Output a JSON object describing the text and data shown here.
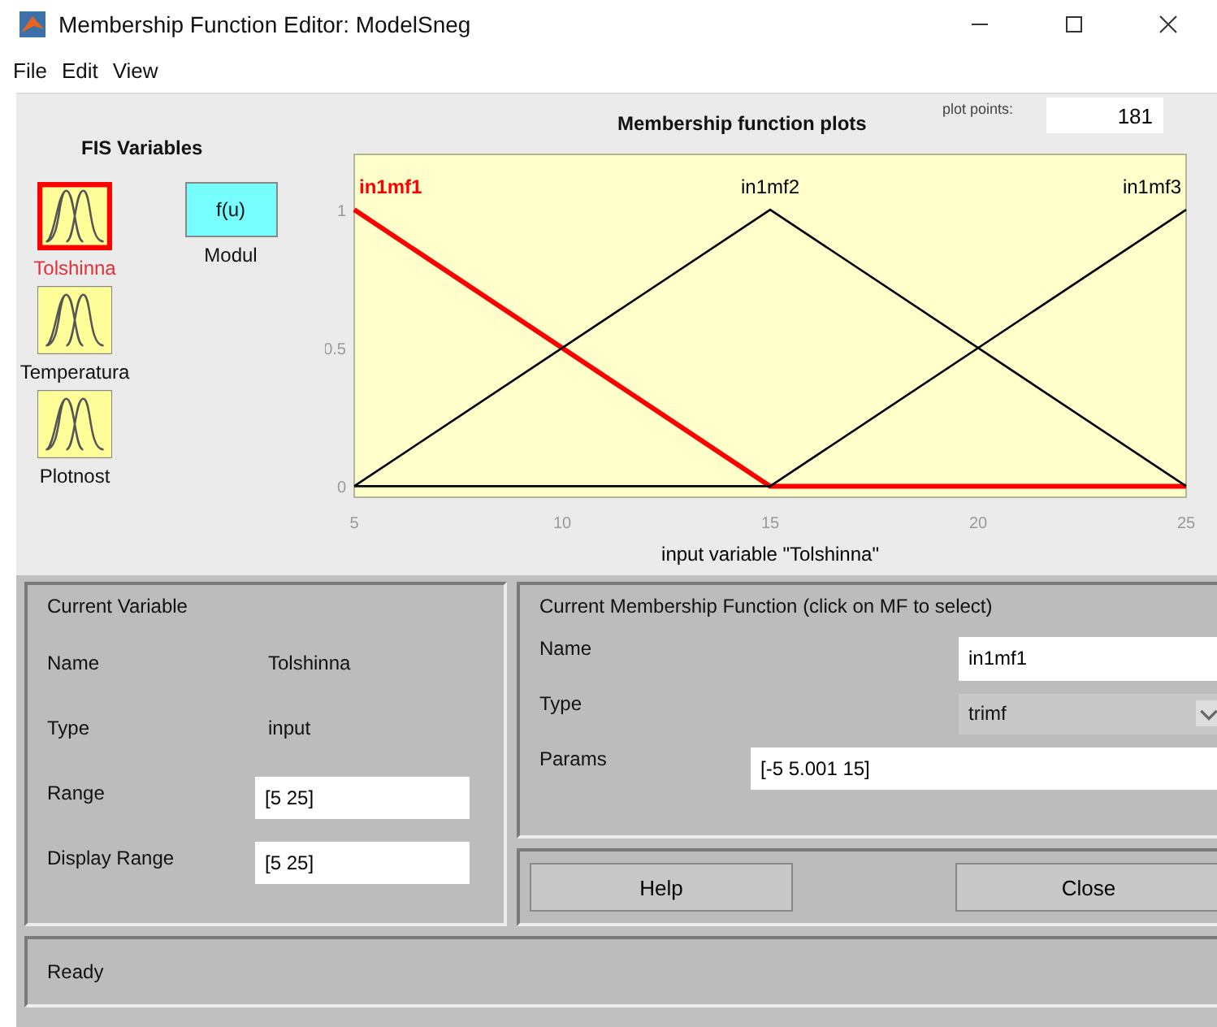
{
  "window": {
    "title": "Membership Function Editor: ModelSneg"
  },
  "menu": [
    "File",
    "Edit",
    "View"
  ],
  "fis_variables": {
    "title": "FIS Variables",
    "items": [
      {
        "label": "Tolshinna",
        "kind": "input",
        "selected": true
      },
      {
        "label": "Modul",
        "kind": "output",
        "icon_text": "f(u)",
        "selected": false
      },
      {
        "label": "Temperatura",
        "kind": "input",
        "selected": false
      },
      {
        "label": "Plotnost",
        "kind": "input",
        "selected": false
      }
    ]
  },
  "plot_points": {
    "label": "plot points:",
    "value": "181"
  },
  "plot": {
    "chart_data": {
      "type": "line",
      "title": "Membership function plots",
      "xlabel": "input variable \"Tolshinna\"",
      "x": [
        5,
        15,
        25
      ],
      "series": [
        {
          "name": "in1mf1",
          "color": "#ff0000",
          "values": [
            1,
            0,
            0
          ]
        },
        {
          "name": "in1mf2",
          "color": "#000000",
          "values": [
            0,
            1,
            0
          ]
        },
        {
          "name": "in1mf3",
          "color": "#000000",
          "values": [
            0,
            0,
            1
          ]
        }
      ],
      "xlim": [
        5,
        25
      ],
      "ylim": [
        -0.04,
        1.2
      ],
      "xticks": [
        5,
        10,
        15,
        20,
        25
      ],
      "yticks": [
        0,
        {
          "value": 0.5,
          "label": "0.5"
        },
        1
      ]
    }
  },
  "current_variable": {
    "title": "Current Variable",
    "name_label": "Name",
    "name": "Tolshinna",
    "type_label": "Type",
    "type": "input",
    "range_label": "Range",
    "range": "[5 25]",
    "display_range_label": "Display Range",
    "display_range": "[5 25]"
  },
  "current_mf": {
    "title": "Current Membership Function (click on MF to select)",
    "name_label": "Name",
    "name": "in1mf1",
    "type_label": "Type",
    "type": "trimf",
    "params_label": "Params",
    "params": "[-5 5.001 15]"
  },
  "buttons": [
    "Help",
    "Close"
  ],
  "status_bar": "Ready"
}
